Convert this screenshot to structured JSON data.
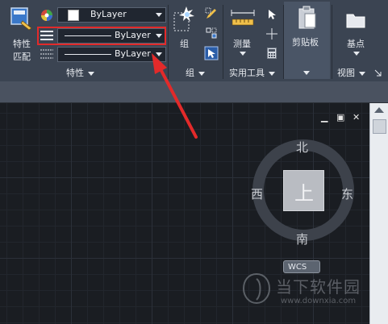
{
  "colors": {
    "ribbon_bg": "#3b4452",
    "canvas_bg": "#1a1d22",
    "highlight_red": "#e32a2a",
    "scrollbar_bg": "#e9ecf0"
  },
  "ribbon": {
    "match_props": {
      "line1": "特性",
      "line2": "匹配",
      "icon": "match-properties-icon"
    },
    "color_combo": {
      "value": "ByLayer",
      "icon": "color-wheel-icon"
    },
    "linetype_combo": {
      "value": "ByLayer",
      "icon": "linetype-icon"
    },
    "lineweight_combo": {
      "value": "ByLayer",
      "icon": "lineweight-icon"
    },
    "properties_panel_title": "特性",
    "group": {
      "label": "组",
      "panel_title": "组",
      "icon": "group-icon"
    },
    "utilities": {
      "measure_label": "测量",
      "panel_title": "实用工具",
      "icon": "measure-icon"
    },
    "clipboard": {
      "label": "剪贴板",
      "icon": "clipboard-icon"
    },
    "base": {
      "label": "基点",
      "icon": "base-point-icon"
    },
    "view_panel_title": "视图"
  },
  "viewport_controls": {
    "minimize": "▁",
    "restore": "▣",
    "close": "✕"
  },
  "viewcube": {
    "north": "北",
    "south": "南",
    "west": "西",
    "east": "东",
    "top_face": "上",
    "wcs_label": "WCS"
  },
  "watermark": {
    "text": "当下软件园",
    "url": "www.downxia.com"
  }
}
